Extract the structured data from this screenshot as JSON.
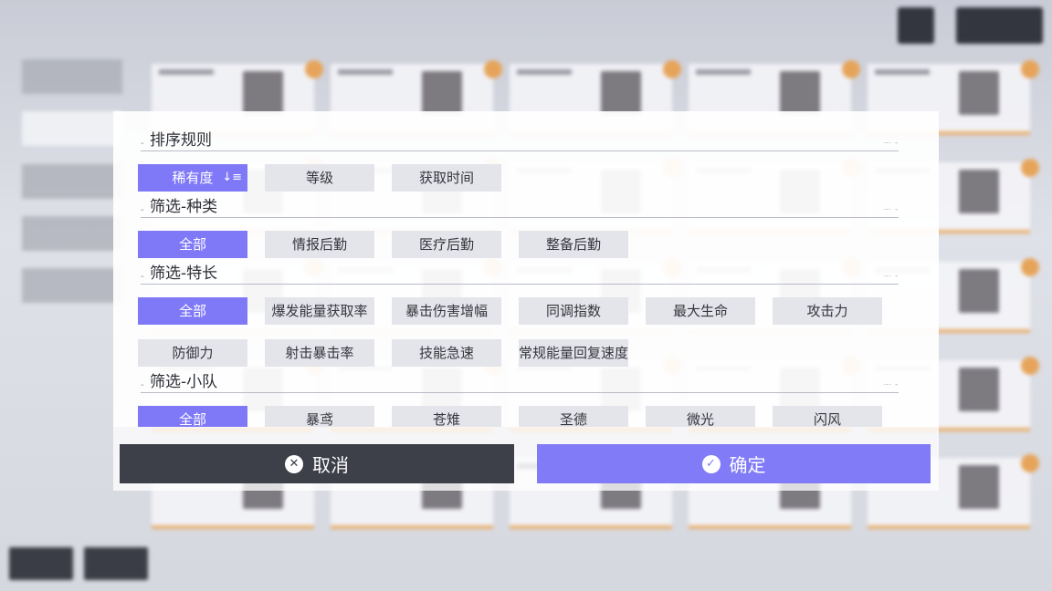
{
  "colors": {
    "accent": "#7f79f7",
    "option_bg": "#e4e5ea",
    "cancel_bg": "#3d3f49",
    "confirm_bg": "#817bf8"
  },
  "dialog": {
    "sections": [
      {
        "title": "排序规则",
        "options": [
          {
            "label": "稀有度",
            "selected": true,
            "icon": "sort-order-icon"
          },
          {
            "label": "等级",
            "selected": false
          },
          {
            "label": "获取时间",
            "selected": false
          }
        ]
      },
      {
        "title": "筛选-种类",
        "options": [
          {
            "label": "全部",
            "selected": true
          },
          {
            "label": "情报后勤",
            "selected": false
          },
          {
            "label": "医疗后勤",
            "selected": false
          },
          {
            "label": "整备后勤",
            "selected": false
          }
        ]
      },
      {
        "title": "筛选-特长",
        "options": [
          {
            "label": "全部",
            "selected": true
          },
          {
            "label": "爆发能量获取率",
            "selected": false
          },
          {
            "label": "暴击伤害增幅",
            "selected": false
          },
          {
            "label": "同调指数",
            "selected": false
          },
          {
            "label": "最大生命",
            "selected": false
          },
          {
            "label": "攻击力",
            "selected": false
          },
          {
            "label": "防御力",
            "selected": false
          },
          {
            "label": "射击暴击率",
            "selected": false
          },
          {
            "label": "技能急速",
            "selected": false
          },
          {
            "label": "常规能量回复速度",
            "selected": false
          }
        ]
      },
      {
        "title": "筛选-小队",
        "options": [
          {
            "label": "全部",
            "selected": true
          },
          {
            "label": "暴鸢",
            "selected": false
          },
          {
            "label": "苍雉",
            "selected": false
          },
          {
            "label": "圣德",
            "selected": false
          },
          {
            "label": "微光",
            "selected": false
          },
          {
            "label": "闪风",
            "selected": false
          }
        ]
      }
    ]
  },
  "footer": {
    "cancel_label": "取消",
    "cancel_icon": "close-circle-icon",
    "confirm_label": "确定",
    "confirm_icon": "check-circle-icon"
  }
}
